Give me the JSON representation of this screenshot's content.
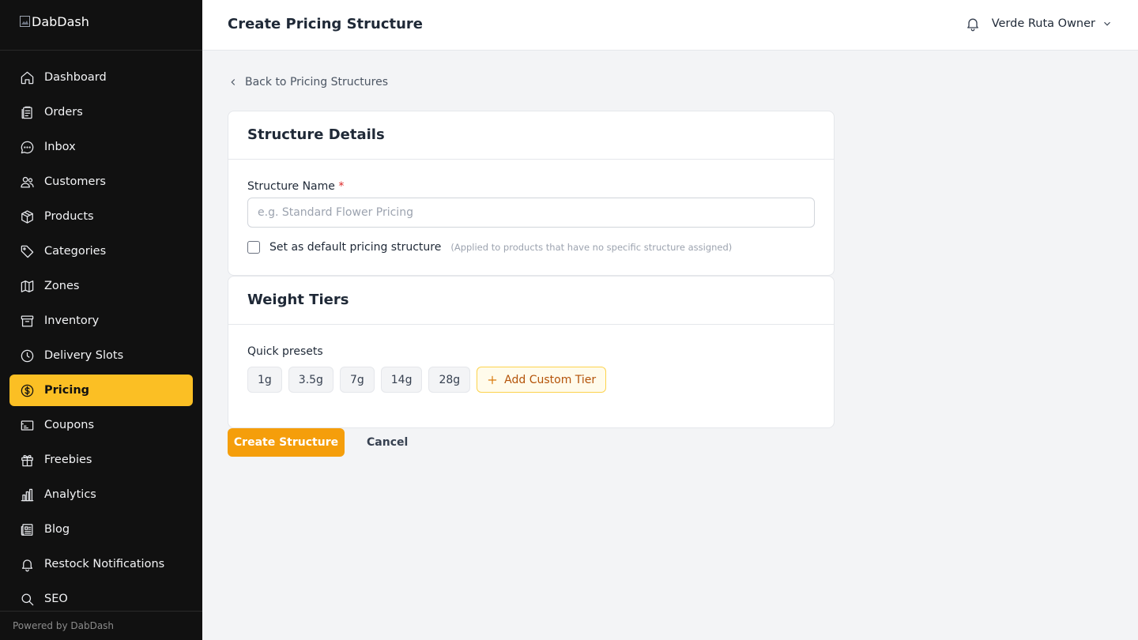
{
  "brand": {
    "logo_alt": "DabDash"
  },
  "sidebar": {
    "items": [
      {
        "label": "Dashboard",
        "icon": "home-icon"
      },
      {
        "label": "Orders",
        "icon": "clipboard-icon"
      },
      {
        "label": "Inbox",
        "icon": "chat-bubble-icon"
      },
      {
        "label": "Customers",
        "icon": "users-icon"
      },
      {
        "label": "Products",
        "icon": "box-icon"
      },
      {
        "label": "Categories",
        "icon": "tag-icon"
      },
      {
        "label": "Zones",
        "icon": "map-icon"
      },
      {
        "label": "Inventory",
        "icon": "archive-icon"
      },
      {
        "label": "Delivery Slots",
        "icon": "clock-icon"
      },
      {
        "label": "Pricing",
        "icon": "dollar-circle-icon",
        "active": true
      },
      {
        "label": "Coupons",
        "icon": "ticket-icon"
      },
      {
        "label": "Freebies",
        "icon": "gift-icon"
      },
      {
        "label": "Analytics",
        "icon": "bar-chart-icon"
      },
      {
        "label": "Blog",
        "icon": "newspaper-icon"
      },
      {
        "label": "Restock Notifications",
        "icon": "bell-icon"
      },
      {
        "label": "SEO",
        "icon": "search-icon"
      }
    ],
    "footer": "Powered by DabDash"
  },
  "header": {
    "title": "Create Pricing Structure",
    "user_name": "Verde Ruta Owner"
  },
  "back_link": "Back to Pricing Structures",
  "structure_details": {
    "title": "Structure Details",
    "name_label": "Structure Name",
    "required_marker": "*",
    "name_placeholder": "e.g. Standard Flower Pricing",
    "name_value": "",
    "default_label": "Set as default pricing structure",
    "default_hint": "(Applied to products that have no specific structure assigned)",
    "default_checked": false
  },
  "weight_tiers": {
    "title": "Weight Tiers",
    "presets_label": "Quick presets",
    "presets": [
      "1g",
      "3.5g",
      "7g",
      "14g",
      "28g"
    ],
    "add_custom_label": "Add Custom Tier"
  },
  "actions": {
    "create_label": "Create Structure",
    "cancel_label": "Cancel"
  },
  "colors": {
    "sidebar_bg": "#111111",
    "accent": "#fbbf24",
    "primary_button": "#f59e0b"
  }
}
